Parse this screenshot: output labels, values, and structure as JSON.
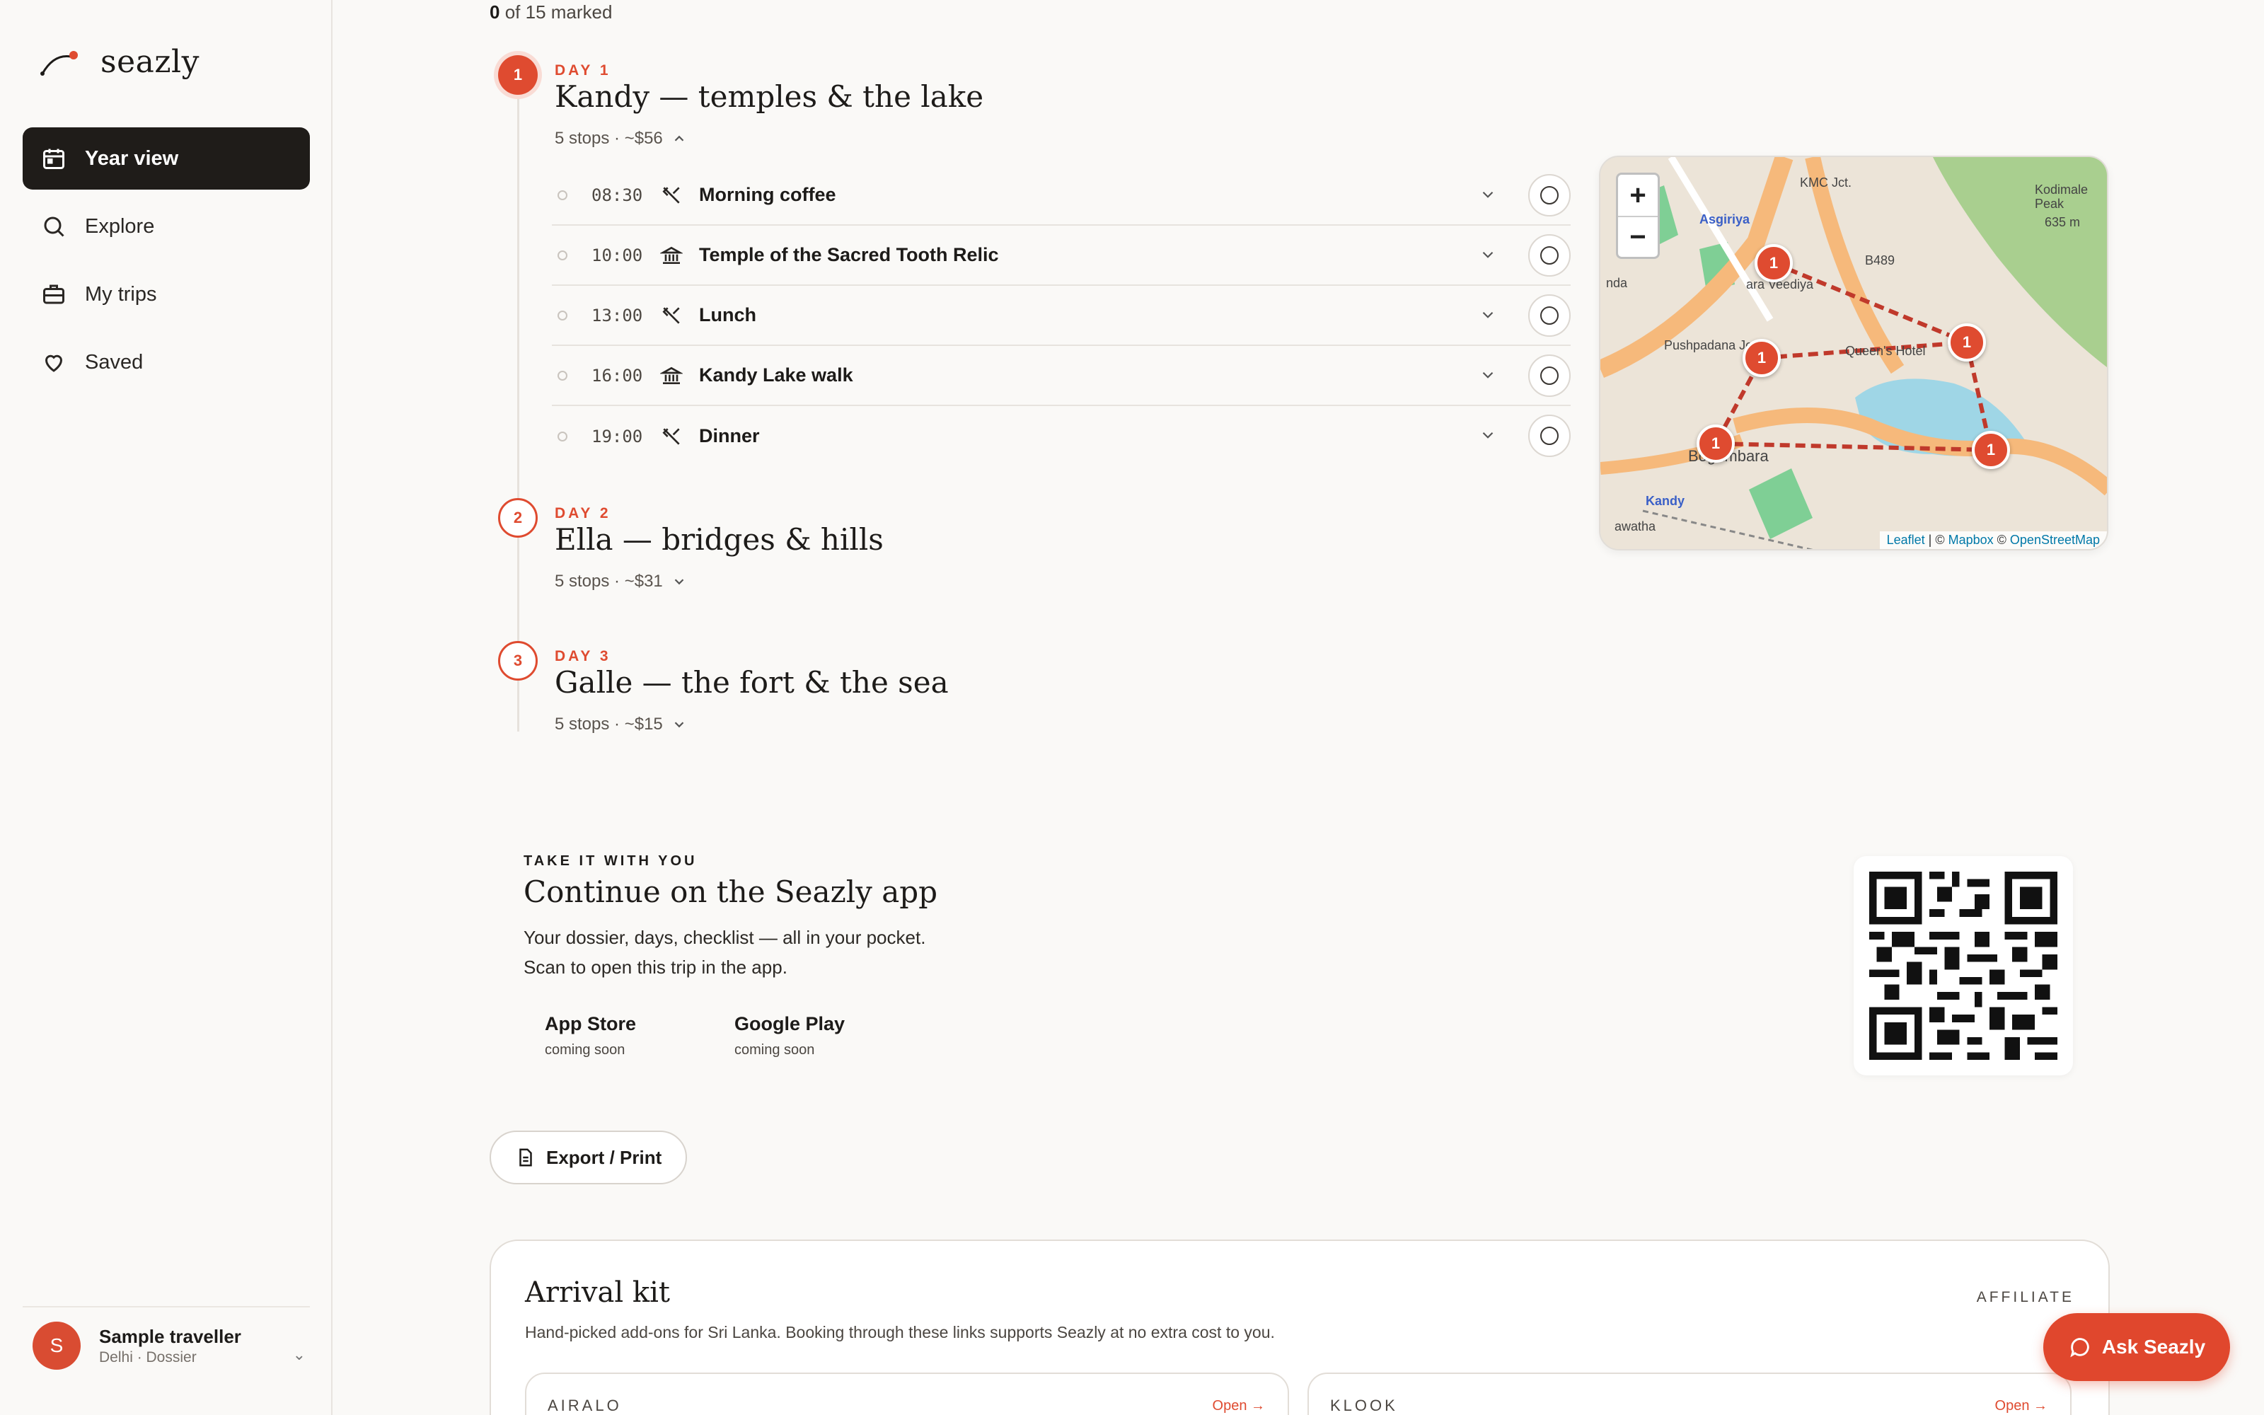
{
  "brand": {
    "name": "seazly"
  },
  "sidebar": {
    "items": [
      {
        "label": "Year view",
        "icon": "calendar-icon",
        "active": true
      },
      {
        "label": "Explore",
        "icon": "search-icon"
      },
      {
        "label": "My trips",
        "icon": "briefcase-icon"
      },
      {
        "label": "Saved",
        "icon": "heart-icon"
      }
    ],
    "user": {
      "initial": "S",
      "name": "Sample traveller",
      "sub": "Delhi · Dossier"
    }
  },
  "progress": {
    "marked": "0",
    "rest": "of 15 marked"
  },
  "days": [
    {
      "label": "DAY 1",
      "number": "1",
      "title": "Kandy — temples & the lake",
      "meta": "5 stops · ~$56",
      "expanded": true,
      "stops": [
        {
          "time": "08:30",
          "icon": "utensils-icon",
          "name": "Morning coffee"
        },
        {
          "time": "10:00",
          "icon": "landmark-icon",
          "name": "Temple of the Sacred Tooth Relic"
        },
        {
          "time": "13:00",
          "icon": "utensils-icon",
          "name": "Lunch"
        },
        {
          "time": "16:00",
          "icon": "landmark-icon",
          "name": "Kandy Lake walk"
        },
        {
          "time": "19:00",
          "icon": "utensils-icon",
          "name": "Dinner"
        }
      ]
    },
    {
      "label": "DAY 2",
      "number": "2",
      "title": "Ella — bridges & hills",
      "meta": "5 stops · ~$31",
      "expanded": false
    },
    {
      "label": "DAY 3",
      "number": "3",
      "title": "Galle — the fort & the sea",
      "meta": "5 stops · ~$15",
      "expanded": false
    }
  ],
  "map": {
    "zoom_in": "+",
    "zoom_out": "−",
    "labels": [
      "KMC Jct.",
      "Asgiriya",
      "B489",
      "Pushpadana Jct.",
      "Queen's Hotel",
      "Bogambara",
      "Kandy",
      "Kodimale Peak",
      "635 m",
      "ara Veediya",
      "nda",
      "awatha"
    ],
    "markers": [
      "1",
      "1",
      "1",
      "1",
      "1"
    ],
    "attribution": {
      "leaflet": "Leaflet",
      "sep1": " | © ",
      "mapbox": "Mapbox",
      "sep2": " © ",
      "osm": "OpenStreetMap"
    }
  },
  "promo": {
    "kicker": "TAKE IT WITH YOU",
    "title": "Continue on the Seazly app",
    "line1": "Your dossier, days, checklist — all in your pocket.",
    "line2": "Scan to open this trip in the app.",
    "stores": [
      {
        "name": "App Store",
        "sub": "coming soon"
      },
      {
        "name": "Google Play",
        "sub": "coming soon"
      }
    ]
  },
  "export": {
    "label": "Export / Print"
  },
  "kit": {
    "title": "Arrival kit",
    "tag": "AFFILIATE",
    "desc": "Hand-picked add-ons for Sri Lanka. Booking through these links supports Seazly at no extra cost to you.",
    "partners": [
      {
        "name": "AIRALO",
        "open": "Open →"
      },
      {
        "name": "KLOOK",
        "open": "Open →"
      }
    ]
  },
  "ask": {
    "label": "Ask Seazly"
  },
  "colors": {
    "accent": "#df4b30",
    "dark": "#1f1c19",
    "background": "#faf9f7"
  }
}
